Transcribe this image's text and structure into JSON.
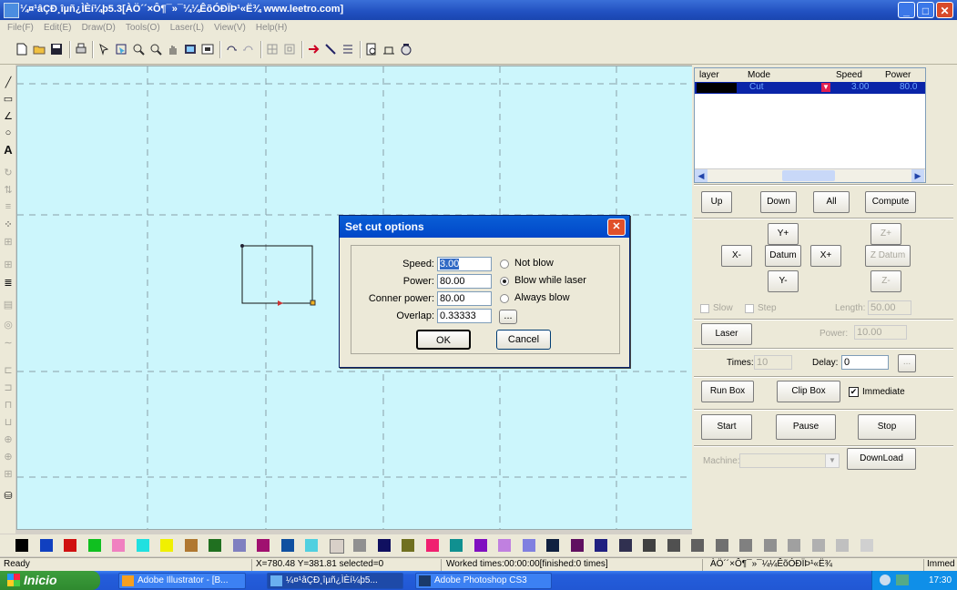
{
  "window": {
    "title": "¼¤¹âÇÐ¸îµñ¿ÌÈí¼þ5.3[ÀÖ´´×Ô¶¯»¯¼¼ÊõÓÐÏÞ¹«Ë¾ www.leetro.com]",
    "minimize": "_",
    "maximize": "□",
    "close": "✕"
  },
  "menu": [
    "File(F)",
    "Edit(E)",
    "Draw(D)",
    "Tools(O)",
    "Laser(L)",
    "View(V)",
    "Help(H)"
  ],
  "dialog": {
    "title": "Set cut options",
    "close": "✕",
    "speed_label": "Speed:",
    "speed_value": "3.00",
    "power_label": "Power:",
    "power_value": "80.00",
    "conner_label": "Conner power:",
    "conner_value": "80.00",
    "overlap_label": "Overlap:",
    "overlap_value": "0.33333",
    "browse": "...",
    "radio_not_blow": "Not blow",
    "radio_blow_while": "Blow while laser",
    "radio_always": "Always blow",
    "ok": "OK",
    "cancel": "Cancel"
  },
  "layers": {
    "headers": [
      "layer",
      "Mode",
      "Speed",
      "Power"
    ],
    "rows": [
      {
        "mode": "Cut",
        "speed": "3.00",
        "power": "80.0"
      }
    ]
  },
  "panel": {
    "up": "Up",
    "down": "Down",
    "all": "All",
    "compute": "Compute",
    "yplus": "Y+",
    "zplus": "Z+",
    "xminus": "X-",
    "datum": "Datum",
    "xplus": "X+",
    "zdatum": "Z Datum",
    "yminus": "Y-",
    "zminus": "Z-",
    "slow": "Slow",
    "step": "Step",
    "length_label": "Length:",
    "length_value": "50.00",
    "laser": "Laser",
    "power_label": "Power:",
    "power_value": "10.00",
    "times_label": "Times:",
    "times_value": "10",
    "delay_label": "Delay:",
    "delay_value": "0",
    "browse": "...",
    "run_box": "Run Box",
    "clip_box": "Clip Box",
    "immediate": "Immediate",
    "start": "Start",
    "pause": "Pause",
    "stop": "Stop",
    "machine_label": "Machine:",
    "download": "DownLoad"
  },
  "status": {
    "ready": "Ready",
    "coords": "X=780.48 Y=381.81 selected=0",
    "worked": "Worked times:00:00:00[finished:0 times]",
    "company": "ÀÖ´´×Ô¶¯»¯¼¼ÊõÓÐÏÞ¹«Ë¾",
    "immed": "Immed"
  },
  "taskbar": {
    "start": "Inicio",
    "tasks": [
      "Adobe Illustrator - [B...",
      "¼¤¹âÇÐ¸îµñ¿ÌÈí¼þ5...",
      "Adobe Photoshop CS3"
    ],
    "clock": "17:30"
  },
  "colors": {
    "canvas": "#ccf6fc",
    "titlebar": "#2150c0",
    "layer_selected": "#0a24a8",
    "palette": [
      "#000000",
      "#1040c0",
      "#d01010",
      "#10c020",
      "#f080c0",
      "#20e0e0",
      "#f0f000",
      "#b07830",
      "#207020",
      "#8080c0",
      "#a01070",
      "#1050a0",
      "#50d0e0",
      "#d8d0c8",
      "#909090",
      "#101060",
      "#707020",
      "#f02070",
      "#109090",
      "#8010c0",
      "#c080e0",
      "#8080e0",
      "#102040",
      "#601060",
      "#202080",
      "#303050",
      "#404040",
      "#505050",
      "#606060",
      "#707070",
      "#808080",
      "#909090",
      "#a0a0a0",
      "#b0b0b0",
      "#c0c0c0",
      "#d0d0d0"
    ]
  }
}
